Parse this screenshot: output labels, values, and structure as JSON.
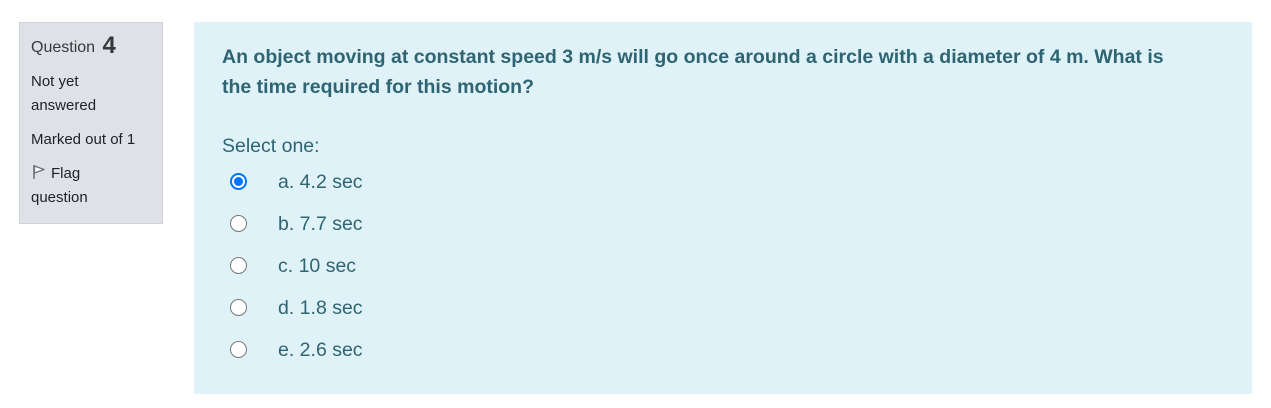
{
  "question_info": {
    "label": "Question",
    "number": "4",
    "state_line1": "Not yet",
    "state_line2": "answered",
    "grade": "Marked out of 1",
    "flag_line1": "Flag",
    "flag_line2": "question"
  },
  "question": {
    "text_line1": "An object moving at constant speed 3 m/s will go once around a circle with a diameter of 4 m. What is",
    "text_line2": "the time required for this motion?",
    "prompt": "Select one:",
    "selected_index": 0,
    "options": [
      {
        "label": "a. 4.2 sec",
        "checked": true
      },
      {
        "label": "b. 7.7 sec",
        "checked": false
      },
      {
        "label": "c. 10 sec",
        "checked": false
      },
      {
        "label": "d. 1.8 sec",
        "checked": false
      },
      {
        "label": "e. 2.6 sec",
        "checked": false
      }
    ]
  },
  "colors": {
    "info_bg": "#dee2e6",
    "content_bg": "#def2f8",
    "question_text": "#2f6473",
    "radio_selected": "#0075ff"
  },
  "icons": {
    "flag": "flag-icon"
  }
}
